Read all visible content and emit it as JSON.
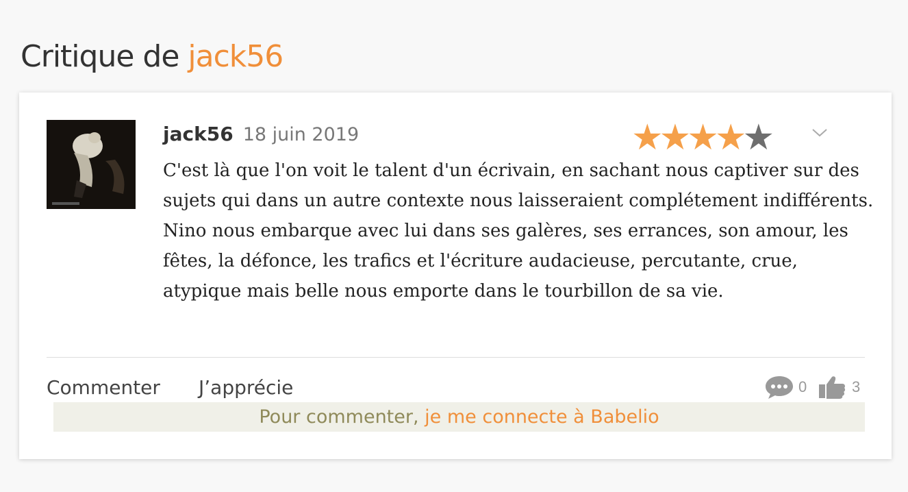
{
  "header": {
    "title_prefix": "Critique de ",
    "title_user": "jack56"
  },
  "review": {
    "author": "jack56",
    "date": "18 juin 2019",
    "rating": 4,
    "rating_max": 5,
    "paragraphs": [
      "C'est là que l'on voit le talent d'un écrivain, en sachant nous captiver sur des sujets qui dans un autre contexte nous laisseraient complétement indifférents.",
      "Nino nous embarque avec lui dans ses galères, ses errances, son amour, les fêtes, la défonce, les trafics et l'écriture audacieuse, percutante, crue, atypique mais belle nous emporte dans le tourbillon de sa vie."
    ]
  },
  "actions": {
    "comment_label": "Commenter",
    "like_label": "J’apprécie",
    "comment_count": "0",
    "like_count": "3"
  },
  "login": {
    "lead": "Pour commenter, ",
    "link": "je me connecte à Babelio"
  },
  "colors": {
    "accent": "#f08f3a",
    "star_on": "#f5a04a",
    "star_off": "#6e6e6e"
  },
  "icons": {
    "options": "chevron-down-icon",
    "comments": "speech-bubble-icon",
    "likes": "thumbs-up-icon"
  }
}
